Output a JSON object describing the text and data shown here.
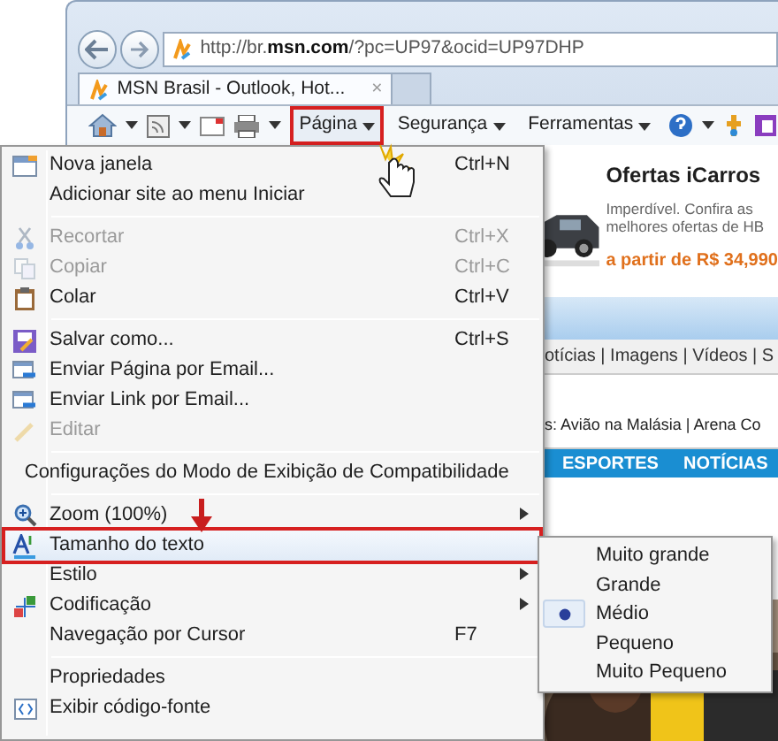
{
  "browser": {
    "address_bar": {
      "url": "http://br.**msn.com**/?pc=UP97&ocid=UP97DHP"
    },
    "tab": {
      "title": "MSN Brasil - Outlook, Hot...",
      "close": "×"
    },
    "command_bar": [
      {
        "label": "Página",
        "highlighted": true
      },
      {
        "label": "Segurança",
        "highlighted": false
      },
      {
        "label": "Ferramentas",
        "highlighted": false
      }
    ]
  },
  "menu": {
    "items": [
      {
        "kind": "item",
        "label": "Nova janela",
        "shortcut": "Ctrl+N",
        "disabled": false,
        "submenu": false,
        "highlighted": false
      },
      {
        "kind": "item",
        "label": "Adicionar site ao menu Iniciar",
        "disabled": false,
        "submenu": false,
        "highlighted": false
      },
      {
        "kind": "separator"
      },
      {
        "kind": "item",
        "label": "Recortar",
        "shortcut": "Ctrl+X",
        "disabled": true,
        "submenu": false,
        "highlighted": false
      },
      {
        "kind": "item",
        "label": "Copiar",
        "shortcut": "Ctrl+C",
        "disabled": true,
        "submenu": false,
        "highlighted": false
      },
      {
        "kind": "item",
        "label": "Colar",
        "shortcut": "Ctrl+V",
        "disabled": false,
        "submenu": false,
        "highlighted": false
      },
      {
        "kind": "separator"
      },
      {
        "kind": "item",
        "label": "Salvar como...",
        "shortcut": "Ctrl+S",
        "disabled": false,
        "submenu": false,
        "highlighted": false
      },
      {
        "kind": "item",
        "label": "Enviar Página por Email...",
        "disabled": false,
        "submenu": false,
        "highlighted": false
      },
      {
        "kind": "item",
        "label": "Enviar Link por Email...",
        "disabled": false,
        "submenu": false,
        "highlighted": false
      },
      {
        "kind": "item",
        "label": "Editar",
        "disabled": true,
        "submenu": false,
        "highlighted": false
      },
      {
        "kind": "separator"
      },
      {
        "kind": "item",
        "label": "Configurações do Modo de Exibição de Compatibilidade",
        "disabled": false,
        "submenu": false,
        "highlighted": false
      },
      {
        "kind": "separator"
      },
      {
        "kind": "item",
        "label": "Zoom (100%)",
        "disabled": false,
        "submenu": true,
        "highlighted": false
      },
      {
        "kind": "item",
        "label": "Tamanho do texto",
        "disabled": false,
        "submenu": false,
        "highlighted": true
      },
      {
        "kind": "item",
        "label": "Estilo",
        "disabled": false,
        "submenu": true,
        "highlighted": false
      },
      {
        "kind": "item",
        "label": "Codificação",
        "disabled": false,
        "submenu": true,
        "highlighted": false
      },
      {
        "kind": "item",
        "label": "Navegação por Cursor",
        "shortcut": "F7",
        "disabled": false,
        "submenu": false,
        "highlighted": false
      },
      {
        "kind": "separator"
      },
      {
        "kind": "item",
        "label": "Propriedades",
        "disabled": false,
        "submenu": false,
        "highlighted": false
      },
      {
        "kind": "item",
        "label": "Exibir código-fonte",
        "disabled": false,
        "submenu": false,
        "highlighted": false
      }
    ]
  },
  "submenu": {
    "items": [
      {
        "label": "Muito grande",
        "selected": false
      },
      {
        "label": "Grande",
        "selected": false
      },
      {
        "label": "Médio",
        "selected": true
      },
      {
        "label": "Pequeno",
        "selected": false
      },
      {
        "label": "Muito Pequeno",
        "selected": false
      }
    ]
  },
  "page": {
    "ad": {
      "title": "Ofertas iCarros",
      "text_lines": [
        "Imperdível. Confira as",
        "melhores ofertas de HB"
      ],
      "price": "a partir de R$ 34,990"
    },
    "nav": "otícias | Imagens | Vídeos | S",
    "trending": "s:  Avião na Malásia | Arena Co",
    "sections": [
      "ESPORTES",
      "NOTÍCIAS"
    ]
  }
}
